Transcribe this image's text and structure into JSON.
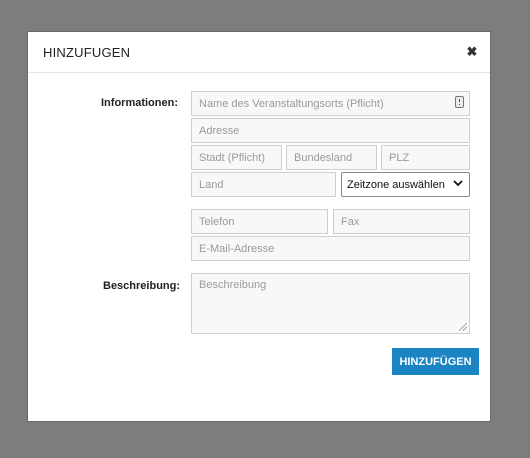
{
  "modal": {
    "title": "HINZUFUGEN",
    "close_glyph": "✖"
  },
  "labels": {
    "informationen": "Informationen:",
    "beschreibung": "Beschreibung:"
  },
  "fields": {
    "venue_name": "Name des Veranstaltungsorts (Pflicht)",
    "address": "Adresse",
    "city": "Stadt (Pflicht)",
    "state": "Bundesland",
    "zip": "PLZ",
    "country": "Land",
    "timezone_selected": "Zeitzone auswählen",
    "phone": "Telefon",
    "fax": "Fax",
    "email": "E-Mail-Adresse",
    "description": "Beschreibung"
  },
  "buttons": {
    "submit": "HINZUFÜGEN"
  },
  "colors": {
    "backdrop": "#7d7d7d",
    "primary_button": "#1a85c2"
  },
  "icons": {
    "close": "close-icon",
    "venue_field": "contact-card-icon",
    "select": "chevron-down-icon"
  }
}
